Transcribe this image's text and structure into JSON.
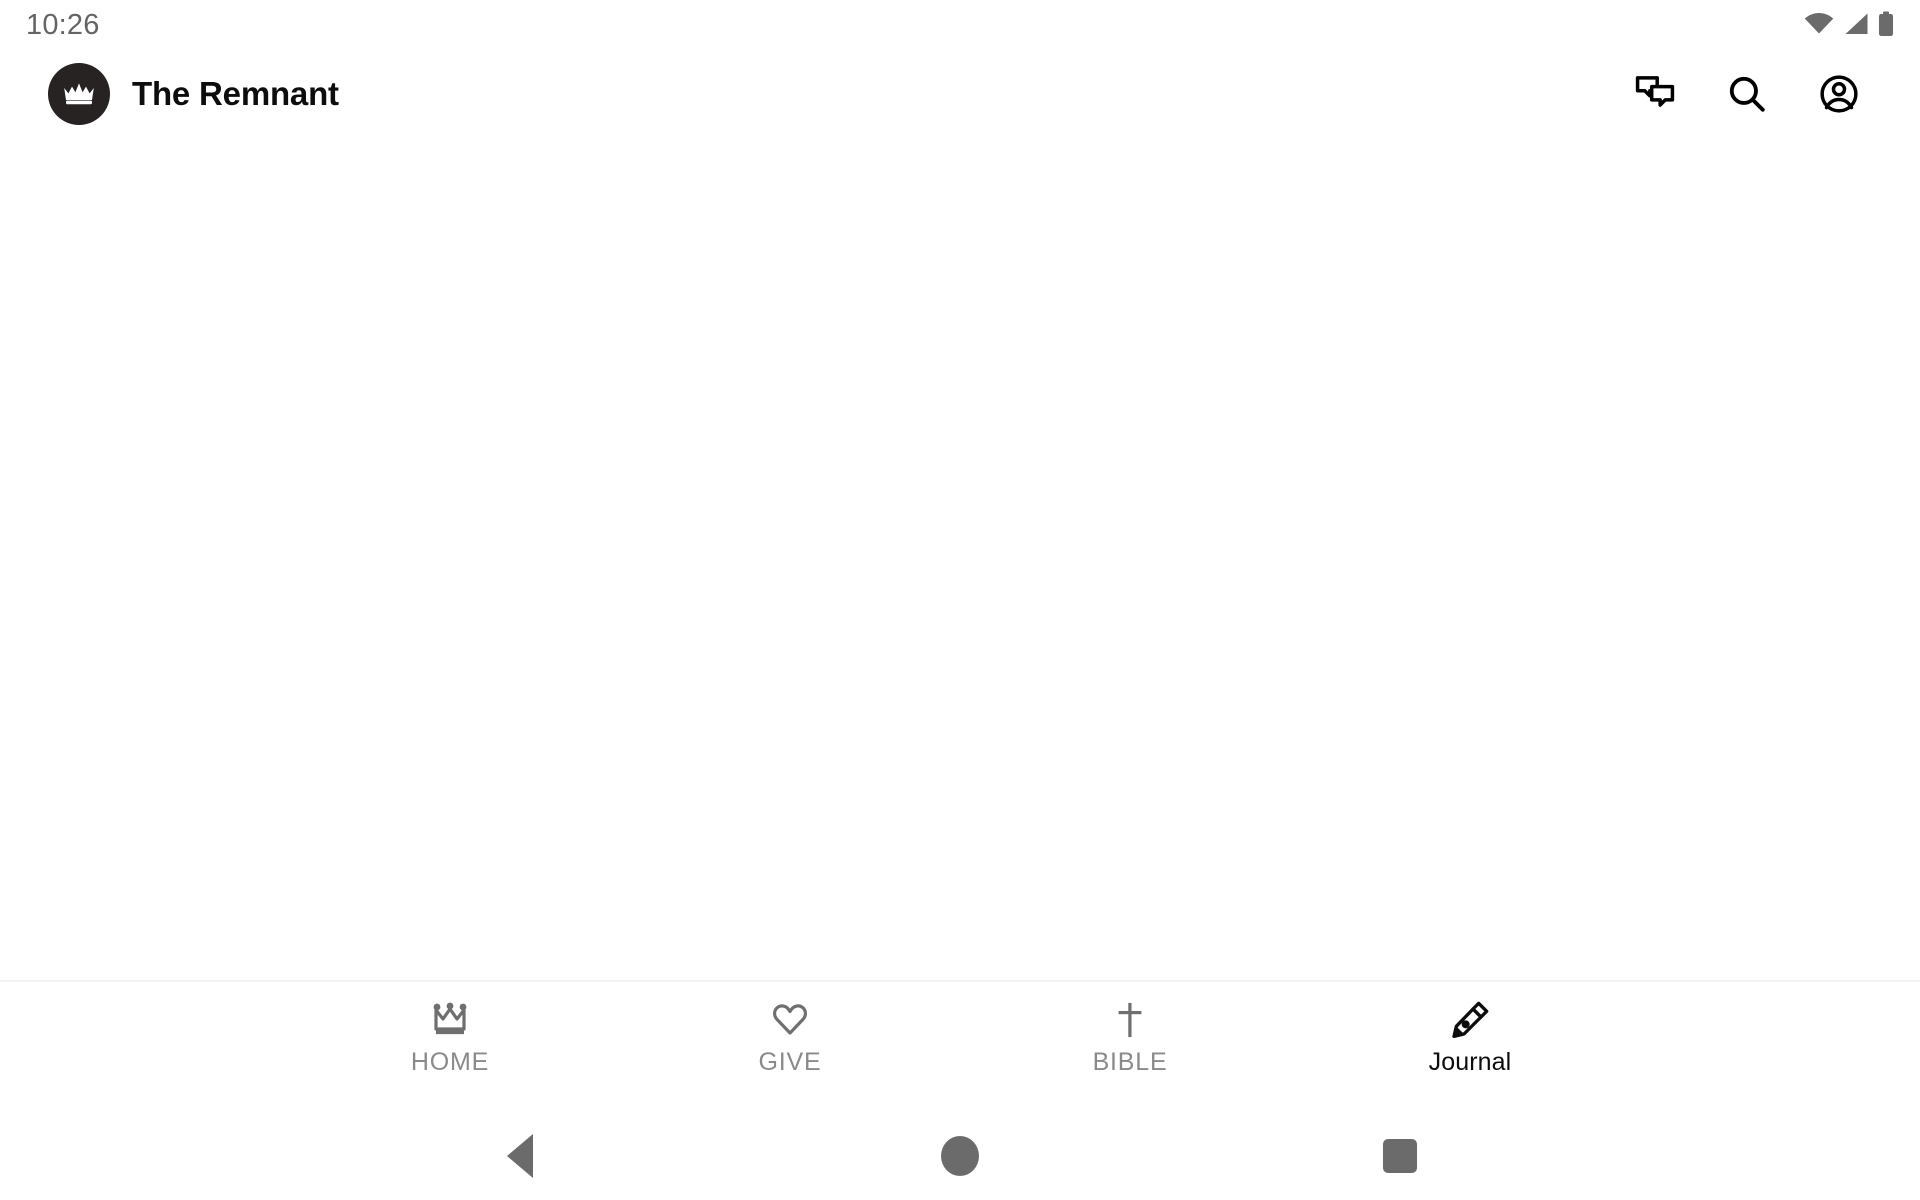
{
  "status_bar": {
    "clock": "10:26",
    "icons": [
      {
        "name": "wifi-icon",
        "label": "Wi-Fi"
      },
      {
        "name": "cellular-signal-icon",
        "label": "Signal"
      },
      {
        "name": "battery-icon",
        "label": "Battery"
      }
    ],
    "icon_color": "#6b6b6b",
    "clock_color": "#646464"
  },
  "app_bar": {
    "logo_icon": "crown-icon",
    "logo_background": "#262322",
    "title": "The Remnant",
    "actions": [
      {
        "name": "messages-icon",
        "label": "Messages"
      },
      {
        "name": "search-icon",
        "label": "Search"
      },
      {
        "name": "account-icon",
        "label": "Account"
      }
    ]
  },
  "content": {
    "body_text": "",
    "background": "#ffffff"
  },
  "tab_bar": {
    "active_index": 3,
    "inactive_color": "#8a8a8a",
    "active_color": "#0d0d0d",
    "tabs": [
      {
        "label": "HOME",
        "icon": "crown-outline-icon",
        "active": false
      },
      {
        "label": "GIVE",
        "icon": "heart-outline-icon",
        "active": false
      },
      {
        "label": "BIBLE",
        "icon": "cross-icon",
        "active": false
      },
      {
        "label": "Journal",
        "icon": "pen-nib-icon",
        "active": true
      }
    ]
  },
  "nav_bar": {
    "color": "#6b6b6b",
    "buttons": [
      {
        "name": "android-back-button",
        "label": "Back"
      },
      {
        "name": "android-home-button",
        "label": "Home"
      },
      {
        "name": "android-recents-button",
        "label": "Recent apps"
      }
    ]
  }
}
